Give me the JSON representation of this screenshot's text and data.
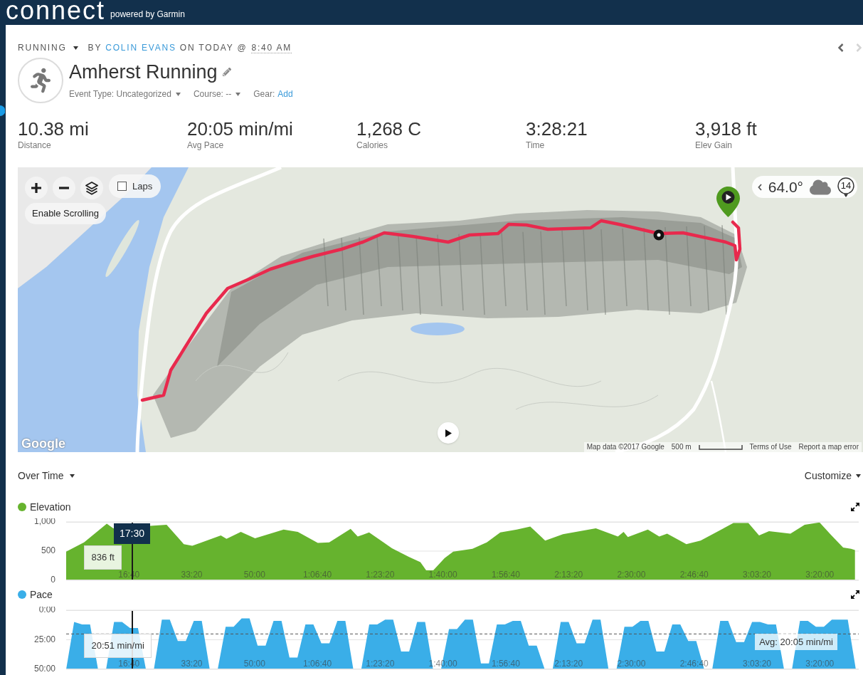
{
  "top_bar": {
    "logo": "connect",
    "tagline": "powered by Garmin"
  },
  "activity": {
    "type": "RUNNING",
    "by_label": "BY",
    "author": "COLIN EVANS",
    "date_label": "ON TODAY @",
    "time": "8:40 AM",
    "nav": [
      {
        "kind": "previous",
        "disabled": false
      },
      {
        "kind": "next",
        "disabled": true
      }
    ],
    "title": "Amherst Running",
    "properties": [
      {
        "kind": "dropdown",
        "label": "Event Type:",
        "value": "Uncategorized"
      },
      {
        "kind": "dropdown",
        "label": "Course:",
        "value": "--"
      },
      {
        "kind": "link",
        "label": "Gear:",
        "value": "Add"
      }
    ]
  },
  "stats": [
    {
      "value": "10.38 mi",
      "label": "Distance"
    },
    {
      "value": "20:05 min/mi",
      "label": "Avg Pace"
    },
    {
      "value": "1,268 C",
      "label": "Calories"
    },
    {
      "value": "3:28:21",
      "label": "Time"
    },
    {
      "value": "3,918 ft",
      "label": "Elev Gain"
    }
  ],
  "map": {
    "controls": [
      {
        "kind": "zoom_in"
      },
      {
        "kind": "zoom_out"
      },
      {
        "kind": "layers"
      }
    ],
    "laps": {
      "label": "Laps",
      "checked": false
    },
    "scroll_button": "Enable Scrolling",
    "weather": {
      "temperature": "64.0°",
      "wind_speed": "14"
    },
    "google_logo": "Google",
    "attribution": {
      "map_data": "Map data ©2017 Google",
      "scale": "500 m",
      "terms": "Terms of Use",
      "report": "Report a map error"
    }
  },
  "charts_header": {
    "view": "Over Time",
    "customize": "Customize"
  },
  "charts": [
    {
      "cursor": {
        "level": 0.083,
        "label": "17:30",
        "reading": "836 ft"
      },
      "chart_data": {
        "type": "area",
        "x": [
          0,
          284,
          647,
          750,
          1050,
          1373,
          1600,
          1873,
          2009,
          2463,
          2554,
          2781,
          3008,
          3462,
          3689,
          4007,
          4188,
          4529,
          4642,
          4824,
          5187,
          5460,
          5641,
          5732,
          5846,
          6027,
          6163,
          6470,
          6697,
          6913,
          7174,
          7390,
          7628,
          7911,
          8434,
          8785,
          8876,
          8944,
          9262,
          9444,
          9569,
          9875,
          10102,
          10624,
          10863,
          11033,
          11192,
          11532,
          11759,
          11997,
          12168,
          12372,
          12497,
          12560
        ],
        "series": [
          {
            "name": "Elevation",
            "color": "#66b32e",
            "values": [
              490,
              650,
              970,
              890,
              null,
              null,
              950,
              620,
              590,
              770,
              710,
              830,
              720,
              870,
              830,
              640,
              650,
              880,
              750,
              820,
              550,
              400,
              310,
              170,
              170,
              380,
              490,
              540,
              650,
              820,
              870,
              920,
              680,
              790,
              890,
              750,
              830,
              740,
              870,
              750,
              800,
              620,
              680,
              980,
              980,
              770,
              840,
              800,
              950,
              990,
              790,
              560,
              540,
              520
            ]
          }
        ],
        "xlim": [
          0,
          12620
        ],
        "ylim": [
          0,
          1000
        ],
        "xticks": [
          {
            "value": 1000,
            "label": "16:40"
          },
          {
            "value": 2000,
            "label": "33:20"
          },
          {
            "value": 3000,
            "label": "50:00"
          },
          {
            "value": 4000,
            "label": "1:06:40"
          },
          {
            "value": 5000,
            "label": "1:23:20"
          },
          {
            "value": 6000,
            "label": "1:40:00"
          },
          {
            "value": 7000,
            "label": "1:56:40"
          },
          {
            "value": 8000,
            "label": "2:13:20"
          },
          {
            "value": 9000,
            "label": "2:30:00"
          },
          {
            "value": 10000,
            "label": "2:46:40"
          },
          {
            "value": 11000,
            "label": "3:03:20"
          },
          {
            "value": 12000,
            "label": "3:20:00"
          }
        ],
        "yticks": [
          0,
          500,
          {
            "value": 1000,
            "label": "1,000"
          }
        ]
      }
    },
    {
      "cursor": {
        "level": 0.083,
        "reading": "20:51 min/mi"
      },
      "chart_data": {
        "type": "area",
        "x": [
          0,
          127,
          254,
          381,
          508,
          635,
          762,
          889,
          1016,
          1143,
          1270,
          1397,
          1524,
          1651,
          1778,
          1905,
          2032,
          2159,
          2286,
          2413,
          2540,
          2667,
          2794,
          2921,
          3048,
          3175,
          3302,
          3429,
          3556,
          3683,
          3810,
          3937,
          4064,
          4191,
          4318,
          4445,
          4572,
          4699,
          4826,
          4953,
          5080,
          5207,
          5334,
          5461,
          5588,
          5715,
          5842,
          5969,
          6096,
          6223,
          6350,
          6477,
          6604,
          6731,
          6858,
          6985,
          7112,
          7239,
          7366,
          7493,
          7620,
          7747,
          7874,
          8001,
          8128,
          8255,
          8382,
          8509,
          8636,
          8763,
          8890,
          9017,
          9144,
          9271,
          9398,
          9525,
          9652,
          9779,
          9906,
          10033,
          10160,
          10287,
          10414,
          10541,
          10668,
          10795,
          10922,
          11049,
          11176,
          11303,
          11430,
          11557,
          11684,
          11811,
          11938,
          12065,
          12192,
          12319,
          12446,
          12573
        ],
        "series": [
          {
            "name": "Pace",
            "color": "#3aaee8",
            "values": [
              50,
              10,
              12,
              12,
              50,
              50,
              10,
              10,
              15,
              15,
              50,
              50,
              8,
              8,
              26,
              26,
              9,
              9,
              50,
              50,
              14,
              14,
              7,
              7,
              30,
              30,
              9,
              9,
              40,
              40,
              12,
              12,
              28,
              28,
              9,
              9,
              50,
              50,
              12,
              12,
              8,
              8,
              35,
              35,
              10,
              10,
              50,
              50,
              16,
              16,
              8,
              8,
              45,
              45,
              12,
              12,
              9,
              9,
              30,
              30,
              50,
              50,
              10,
              10,
              28,
              28,
              8,
              8,
              50,
              50,
              14,
              14,
              9,
              9,
              35,
              35,
              12,
              12,
              26,
              26,
              50,
              50,
              9,
              9,
              27,
              27,
              10,
              10,
              12,
              12,
              50,
              50,
              9,
              9,
              14,
              14,
              8,
              8,
              8,
              50
            ]
          }
        ],
        "xlim": [
          0,
          12620
        ],
        "ylim": [
          50,
          0
        ],
        "xticks": [
          {
            "value": 1000,
            "label": "16:40"
          },
          {
            "value": 2000,
            "label": "33:20"
          },
          {
            "value": 3000,
            "label": "50:00"
          },
          {
            "value": 4000,
            "label": "1:06:40"
          },
          {
            "value": 5000,
            "label": "1:23:20"
          },
          {
            "value": 6000,
            "label": "1:40:00"
          },
          {
            "value": 7000,
            "label": "1:56:40"
          },
          {
            "value": 8000,
            "label": "2:13:20"
          },
          {
            "value": 9000,
            "label": "2:30:00"
          },
          {
            "value": 10000,
            "label": "2:46:40"
          },
          {
            "value": 11000,
            "label": "3:03:20"
          },
          {
            "value": 12000,
            "label": "3:20:00"
          }
        ],
        "yticks": [
          {
            "value": 0,
            "label": "0:00"
          },
          {
            "value": 25,
            "label": "25:00"
          },
          {
            "value": 50,
            "label": "50:00"
          }
        ],
        "ref_lines": [
          {
            "axis": "y",
            "value": 20.08,
            "label": "Avg: 20:05 min/mi"
          }
        ]
      }
    }
  ]
}
